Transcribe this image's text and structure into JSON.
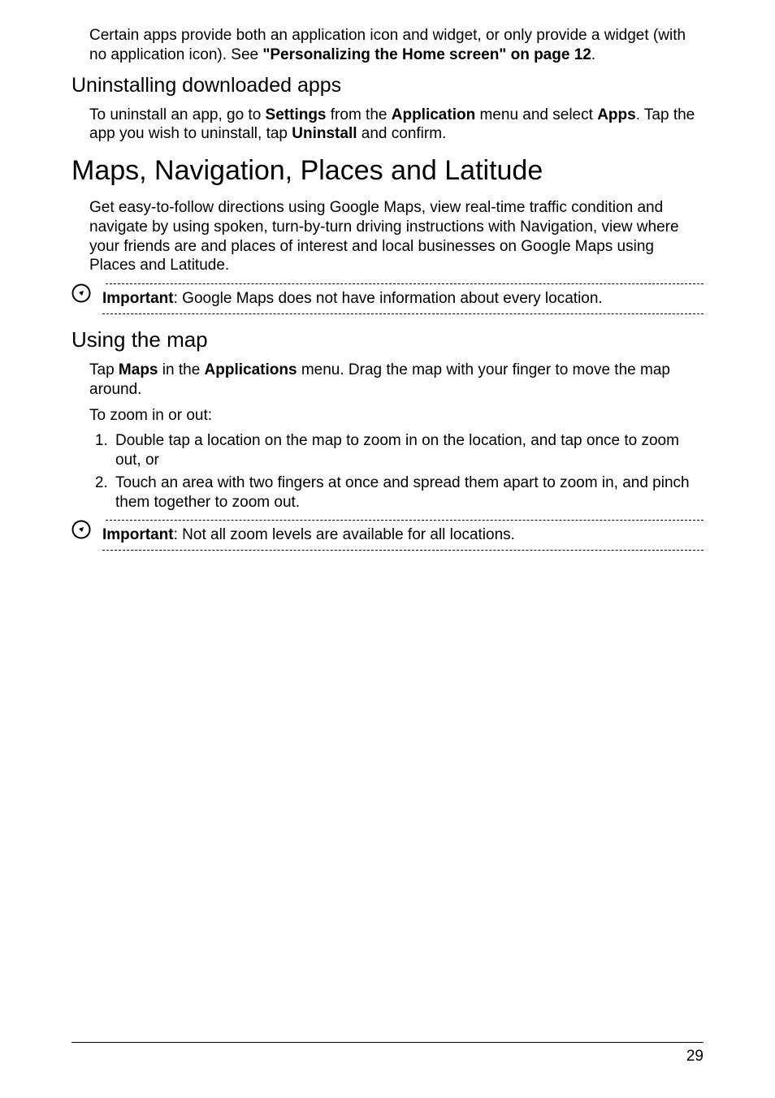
{
  "para1_pre": "Certain apps provide both an application icon and widget, or only provide a widget (with no application icon). See ",
  "para1_bold": "\"Personalizing the Home screen\" on page 12",
  "para1_post": ".",
  "heading_uninstall": "Uninstalling downloaded apps",
  "para2_s1": "To uninstall an app, go to ",
  "para2_b1": "Settings",
  "para2_s2": " from the ",
  "para2_b2": "Application",
  "para2_s3": " menu and select ",
  "para2_b3": "Apps",
  "para2_s4": ". Tap the app you wish to uninstall, tap ",
  "para2_b4": "Uninstall",
  "para2_s5": " and confirm.",
  "heading_maps": "Maps, Navigation, Places and Latitude",
  "para3": "Get easy-to-follow directions using Google Maps, view real-time traffic condition and navigate by using spoken, turn-by-turn driving instructions with Navigation, view where your friends are and places of interest and local businesses on Google Maps using Places and Latitude.",
  "note1_label": "Important",
  "note1_text": ": Google Maps does not have information about every location.",
  "heading_usingmap": "Using the map",
  "para4_s1": "Tap ",
  "para4_b1": "Maps",
  "para4_s2": " in the ",
  "para4_b2": "Applications",
  "para4_s3": " menu. Drag the map with your finger to move the map around.",
  "para5": "To zoom in or out:",
  "li1": "Double tap a location on the map to zoom in on the location, and tap once to zoom out, or",
  "li2": "Touch an area with two fingers at once and spread them apart to zoom in, and pinch them together to zoom out.",
  "note2_label": "Important",
  "note2_text": ": Not all zoom levels are available for all locations.",
  "page_number": "29"
}
